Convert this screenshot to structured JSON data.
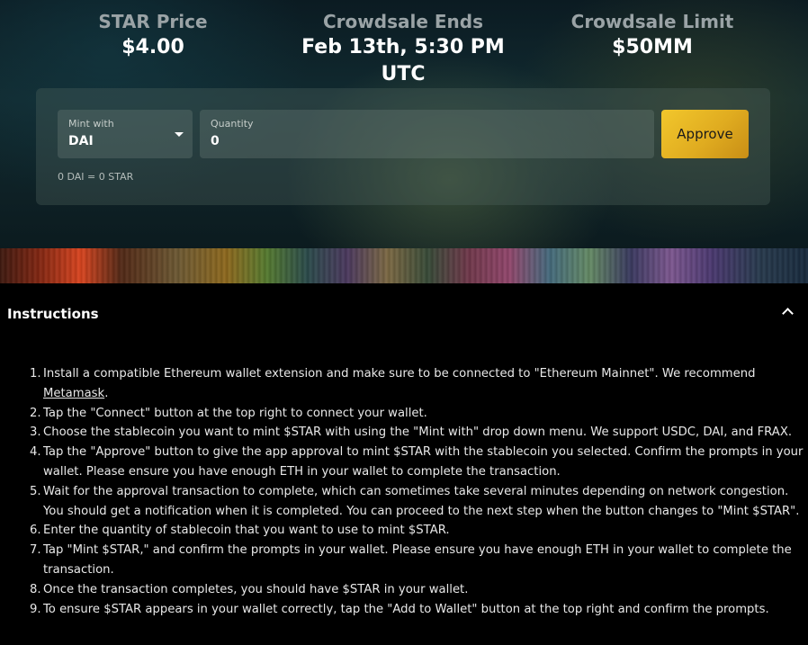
{
  "stats": {
    "price_label": "STAR Price",
    "price_value": "$4.00",
    "ends_label": "Crowdsale Ends",
    "ends_value": "Feb 13th, 5:30 PM UTC",
    "limit_label": "Crowdsale Limit",
    "limit_value": "$50MM"
  },
  "mint_form": {
    "mint_with_label": "Mint with",
    "mint_with_value": "DAI",
    "quantity_label": "Quantity",
    "quantity_value": "0",
    "approve_label": "Approve",
    "conversion_text": "0 DAI = 0 STAR"
  },
  "instructions": {
    "title": "Instructions",
    "items": [
      {
        "num": "1.",
        "text": "Install a compatible Ethereum wallet extension and make sure to be connected to \"Ethereum Mainnet\". We recommend ",
        "link": "Metamask",
        "tail": "."
      },
      {
        "num": "2.",
        "text": "Tap the \"Connect\" button at the top right to connect your wallet."
      },
      {
        "num": "3.",
        "text": "Choose the stablecoin you want to mint $STAR with using the \"Mint with\" drop down menu. We support USDC, DAI, and FRAX."
      },
      {
        "num": "4.",
        "text": "Tap the \"Approve\" button to give the app approval to mint $STAR with the stablecoin you selected. Confirm the prompts in your wallet. Please ensure you have enough ETH in your wallet to complete the transaction."
      },
      {
        "num": "5.",
        "text": "Wait for the approval transaction to complete, which can sometimes take several minutes depending on network congestion. You should get a notification when it is completed. You can proceed to the next step when the button changes to \"Mint $STAR\"."
      },
      {
        "num": "6.",
        "text": "Enter the quantity of stablecoin that you want to use to mint $STAR."
      },
      {
        "num": "7.",
        "text": "Tap \"Mint $STAR,\" and confirm the prompts in your wallet. Please ensure you have enough ETH in your wallet to complete the transaction."
      },
      {
        "num": "8.",
        "text": "Once the transaction completes, you should have $STAR in your wallet."
      },
      {
        "num": "9.",
        "text": "To ensure $STAR appears in your wallet correctly, tap the \"Add to Wallet\" button at the top right and confirm the prompts."
      }
    ]
  }
}
